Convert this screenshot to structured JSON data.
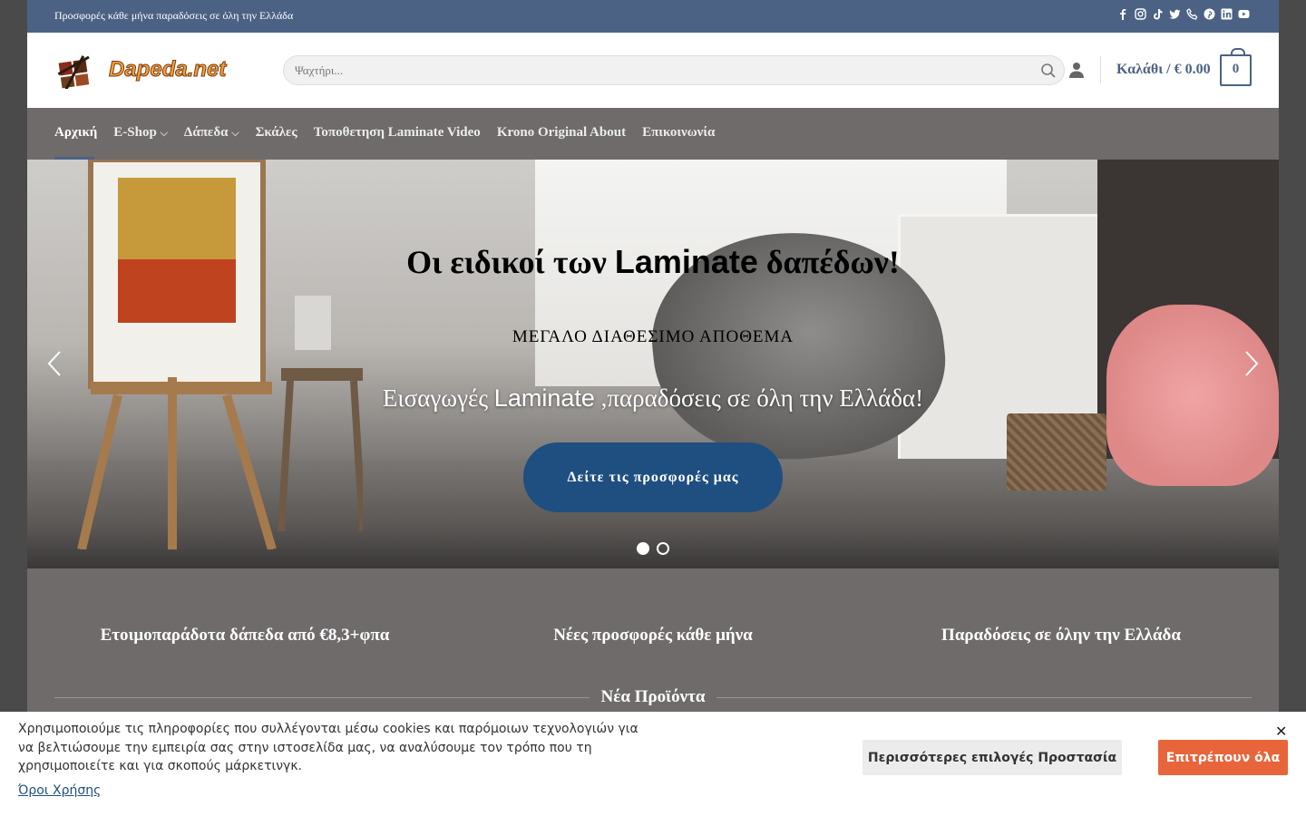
{
  "topbar": {
    "promo": "Προσφορές κάθε μήνα παραδόσεις σε όλη την Ελλάδα",
    "social_icons": [
      "facebook-icon",
      "instagram-icon",
      "tiktok-icon",
      "twitter-icon",
      "phone-icon",
      "pinterest-icon",
      "linkedin-icon",
      "youtube-icon"
    ]
  },
  "header": {
    "logo_text": "Dapeda.net",
    "search_placeholder": "Ψαχτήρι...",
    "cart_label": "Καλάθι / € 0.00",
    "cart_count": "0"
  },
  "nav": {
    "items": [
      {
        "label": "Αρχική"
      },
      {
        "label": "E-Shop"
      },
      {
        "label": "Δάπεδα"
      },
      {
        "label": "Σκάλες"
      },
      {
        "label": "Τοποθετηση Laminate Video"
      },
      {
        "label": "Krono Original About"
      },
      {
        "label": "Επικοινωνία"
      }
    ]
  },
  "hero": {
    "title_a": "Οι ειδικοί των ",
    "title_b": "Laminate",
    "title_c": " δαπέδων!",
    "subtitle": "ΜΕΓΑΛΟ ΔΙΑΘΕΣΙΜΟ ΑΠΟΘΕΜΑ",
    "line_a": "Εισαγωγές ",
    "line_b": "Laminate",
    "line_c": " ,παραδόσεις σε όλη την Ελλάδα!",
    "button": "Δείτε τις προσφορές μας"
  },
  "features": {
    "items": [
      "Ετοιμοπαράδοτα δάπεδα από €8,3+φπα",
      "Νέες προσφορές κάθε μήνα",
      "Παραδόσεις σε όλην την Ελλάδα"
    ],
    "section_title": "Νέα Προϊόντα"
  },
  "cookie": {
    "text": "Χρησιμοποιούμε τις πληροφορίες που συλλέγονται μέσω cookies και παρόμοιων τεχνολογιών για να βελτιώσουμε την εμπειρία σας στην ιστοσελίδα μας, να αναλύσουμε τον τρόπο που τη χρησιμοποιείτε και για σκοπούς μάρκετινγκ.",
    "link": "Όροι Χρήσης",
    "more_button": "Περισσότερες επιλογές Προστασία",
    "allow_button": "Επιτρέπουν όλα",
    "close": "✕"
  },
  "colors": {
    "topbar": "#4b6284",
    "nav": "#6f6b6b",
    "hero_button": "#1e4f80",
    "allow_button": "#e8643b"
  }
}
